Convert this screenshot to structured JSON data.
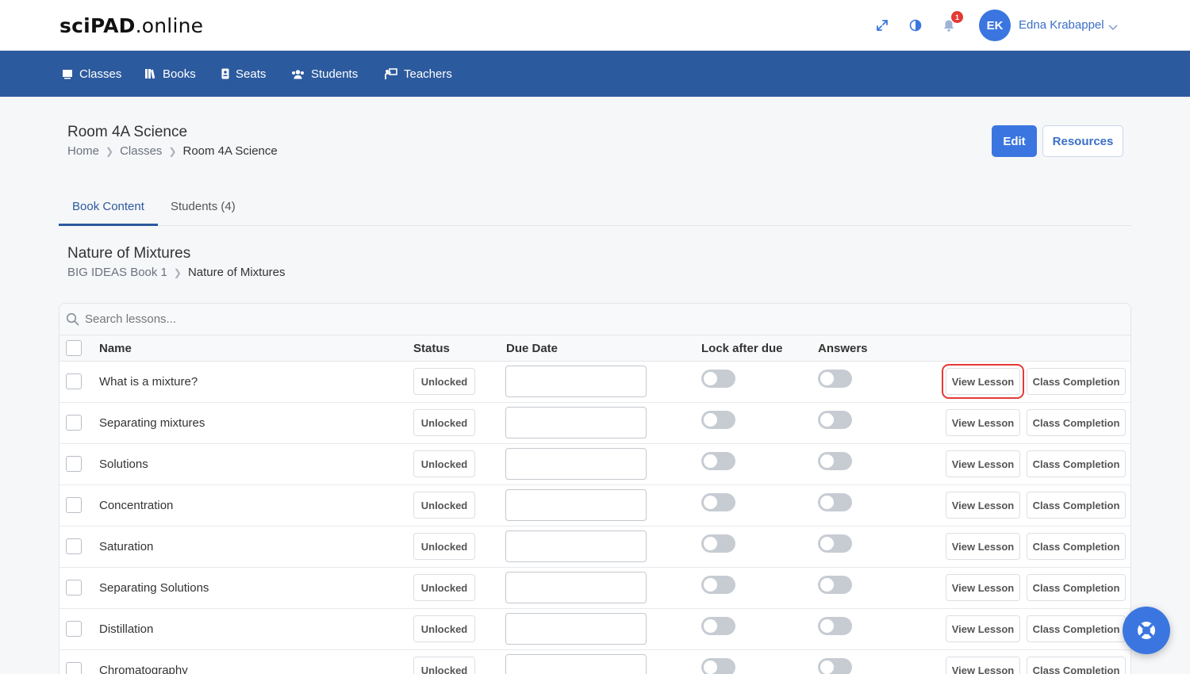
{
  "app": {
    "logo_bold": "sciPAD",
    "logo_rest": ".online"
  },
  "header": {
    "notification_count": "1",
    "avatar_initials": "EK",
    "user_name": "Edna Krabappel"
  },
  "nav": {
    "items": [
      {
        "label": "Classes",
        "icon": "chalkboard-icon"
      },
      {
        "label": "Books",
        "icon": "books-icon"
      },
      {
        "label": "Seats",
        "icon": "id-badge-icon"
      },
      {
        "label": "Students",
        "icon": "users-icon"
      },
      {
        "label": "Teachers",
        "icon": "teacher-icon"
      }
    ]
  },
  "page": {
    "title": "Room 4A Science",
    "breadcrumb": [
      "Home",
      "Classes",
      "Room 4A Science"
    ],
    "edit_label": "Edit",
    "resources_label": "Resources"
  },
  "tabs": [
    {
      "label": "Book Content",
      "active": true
    },
    {
      "label": "Students (4)",
      "active": false
    }
  ],
  "section": {
    "title": "Nature of Mixtures",
    "breadcrumb": [
      "BIG IDEAS Book 1",
      "Nature of Mixtures"
    ]
  },
  "table": {
    "search_placeholder": "Search lessons...",
    "headers": {
      "name": "Name",
      "status": "Status",
      "due_date": "Due Date",
      "lock_after_due": "Lock after due",
      "answers": "Answers"
    },
    "view_label": "View Lesson",
    "completion_label": "Class Completion",
    "rows": [
      {
        "name": "What is a mixture?",
        "status": "Unlocked",
        "due_date": "",
        "lock": false,
        "answers": false
      },
      {
        "name": "Separating mixtures",
        "status": "Unlocked",
        "due_date": "",
        "lock": false,
        "answers": false
      },
      {
        "name": "Solutions",
        "status": "Unlocked",
        "due_date": "",
        "lock": false,
        "answers": false
      },
      {
        "name": "Concentration",
        "status": "Unlocked",
        "due_date": "",
        "lock": false,
        "answers": false
      },
      {
        "name": "Saturation",
        "status": "Unlocked",
        "due_date": "",
        "lock": false,
        "answers": false
      },
      {
        "name": "Separating Solutions",
        "status": "Unlocked",
        "due_date": "",
        "lock": false,
        "answers": false
      },
      {
        "name": "Distillation",
        "status": "Unlocked",
        "due_date": "",
        "lock": false,
        "answers": false
      },
      {
        "name": "Chromatography",
        "status": "Unlocked",
        "due_date": "",
        "lock": false,
        "answers": false
      }
    ]
  },
  "colors": {
    "primary": "#3b76e0",
    "nav_bg": "#2c5a9e",
    "highlight": "#e53935"
  }
}
